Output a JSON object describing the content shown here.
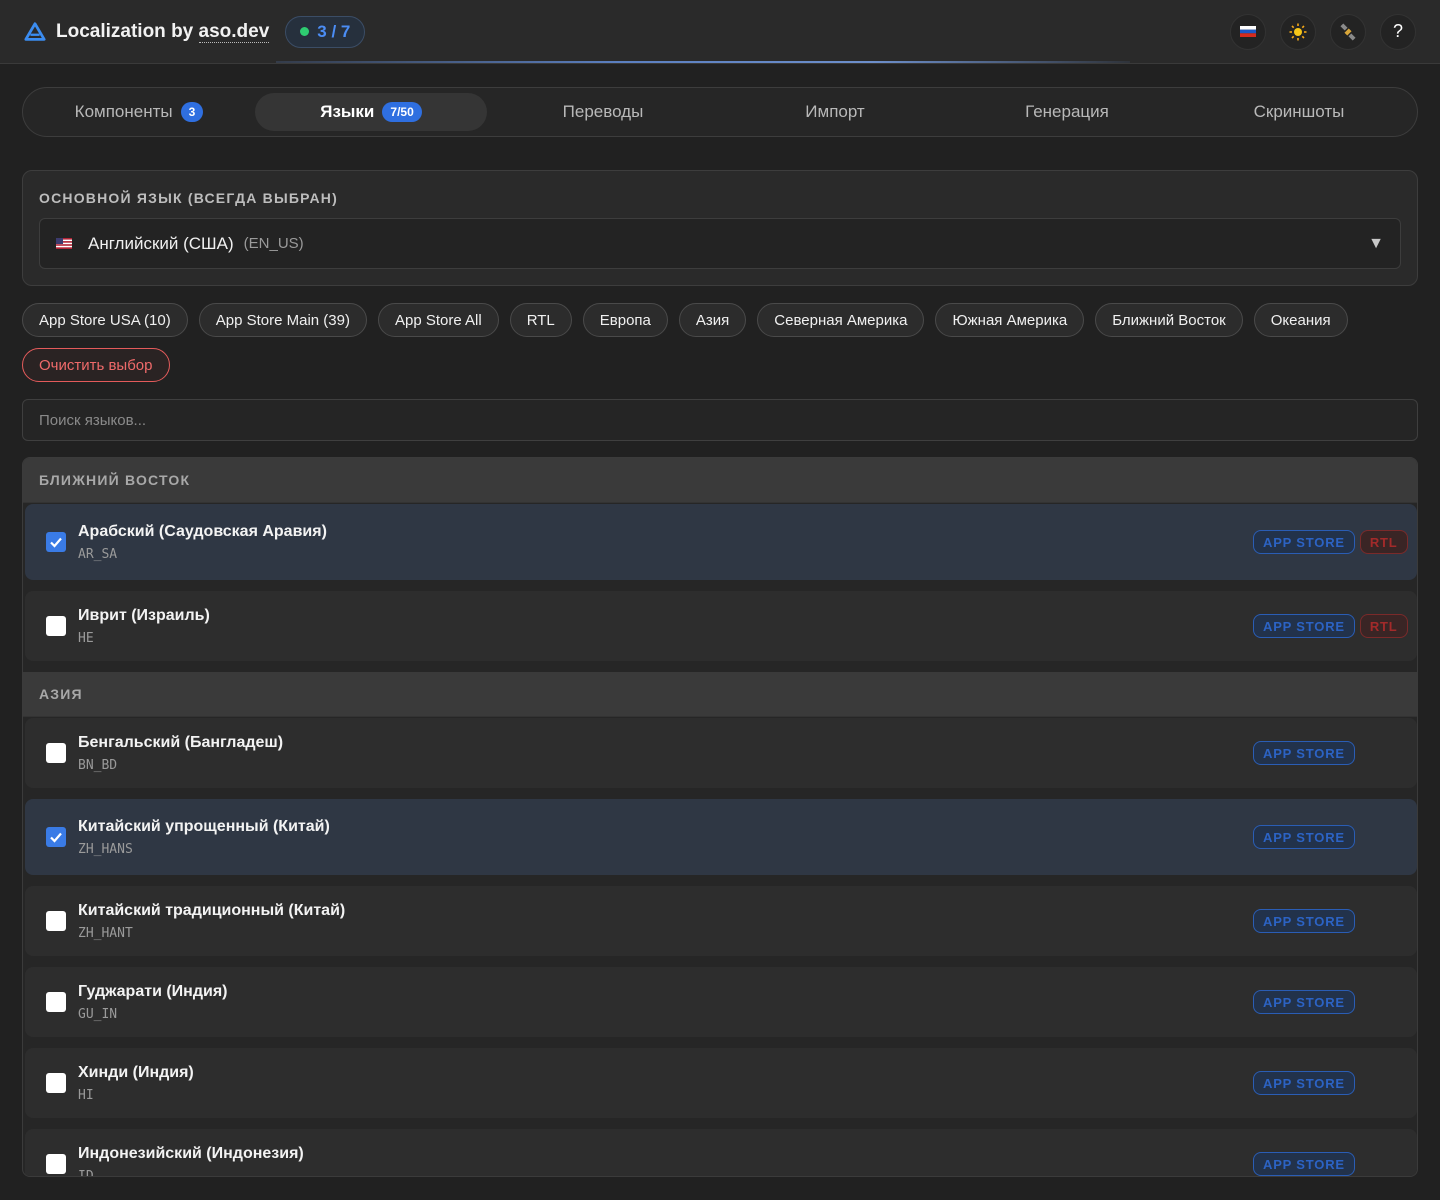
{
  "header": {
    "title_prefix": "Localization by ",
    "title_brand": "aso.dev",
    "status": "3 / 7",
    "help_label": "?"
  },
  "colors": {
    "accent": "#3a7be6",
    "success": "#2ecc71",
    "danger": "#e35b5b",
    "background": "#212121"
  },
  "tabs": [
    {
      "label": "Компоненты",
      "badge": "3"
    },
    {
      "label": "Языки",
      "badge": "7/50"
    },
    {
      "label": "Переводы"
    },
    {
      "label": "Импорт"
    },
    {
      "label": "Генерация"
    },
    {
      "label": "Скриншоты"
    }
  ],
  "primary": {
    "title": "ОСНОВНОЙ ЯЗЫК (ВСЕГДА ВЫБРАН)",
    "name": "Английский (США)",
    "code": "(EN_US)"
  },
  "chips": [
    "App Store USA (10)",
    "App Store Main (39)",
    "App Store All",
    "RTL",
    "Европа",
    "Азия",
    "Северная Америка",
    "Южная Америка",
    "Ближний Восток",
    "Океания"
  ],
  "clear_label": "Очистить выбор",
  "search": {
    "placeholder": "Поиск языков..."
  },
  "tag_labels": {
    "store": "APP STORE",
    "rtl": "RTL"
  },
  "groups": [
    {
      "title": "БЛИЖНИЙ ВОСТОК",
      "items": [
        {
          "name": "Арабский (Саудовская Аравия)",
          "code": "AR_SA"
        },
        {
          "name": "Иврит (Израиль)",
          "code": "HE"
        }
      ]
    },
    {
      "title": "АЗИЯ",
      "items": [
        {
          "name": "Бенгальский (Бангладеш)",
          "code": "BN_BD"
        },
        {
          "name": "Китайский упрощенный (Китай)",
          "code": "ZH_HANS"
        },
        {
          "name": "Китайский традиционный (Китай)",
          "code": "ZH_HANT"
        },
        {
          "name": "Гуджарати (Индия)",
          "code": "GU_IN"
        },
        {
          "name": "Хинди (Индия)",
          "code": "HI"
        },
        {
          "name": "Индонезийский (Индонезия)",
          "code": "ID"
        }
      ]
    }
  ]
}
